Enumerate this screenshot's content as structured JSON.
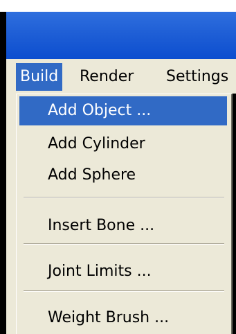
{
  "menu_bar": {
    "build": "Build",
    "render": "Render",
    "settings": "Settings"
  },
  "build_menu": {
    "add_object": "Add Object ...",
    "add_cylinder": "Add Cylinder",
    "add_sphere": "Add Sphere",
    "insert_bone": "Insert Bone ...",
    "joint_limits": "Joint Limits ...",
    "weight_brush": "Weight Brush ..."
  },
  "colors": {
    "title_bar": "#1f5fd6",
    "menu_highlight": "#316ac5",
    "menu_background": "#ece9d8"
  }
}
